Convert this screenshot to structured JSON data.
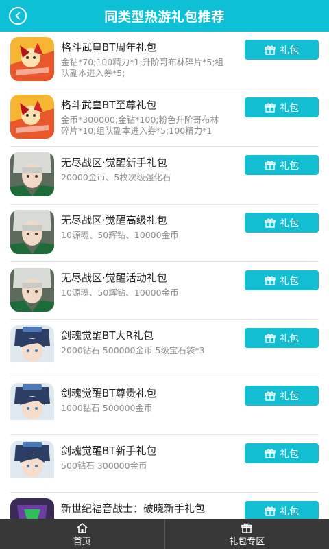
{
  "header": {
    "title": "同类型热游礼包推荐",
    "back_icon": "back-arrow-icon"
  },
  "colors": {
    "accent": "#0ec0d6",
    "button": "#14bed2",
    "tabbar": "#383838"
  },
  "items": [
    {
      "title": "格斗武皇BT周年礼包",
      "desc": "金钻*70;100精力*1;升阶哥布林碎片*5;组队副本进入券*5;",
      "button": "礼包",
      "icon": "fighter-game-icon"
    },
    {
      "title": "格斗武皇BT至尊礼包",
      "desc": "金币*300000;金钻*100;粉色升阶哥布林碎片*10;组队副本进入券*5;100精力*1",
      "button": "礼包",
      "icon": "fighter-game-icon"
    },
    {
      "title": "无尽战区·觉醒新手礼包",
      "desc": "20000金币、5枚次级强化石",
      "button": "礼包",
      "icon": "warzone-game-icon"
    },
    {
      "title": "无尽战区·觉醒高级礼包",
      "desc": "10源魂、50辉钻、10000金币",
      "button": "礼包",
      "icon": "warzone-game-icon"
    },
    {
      "title": "无尽战区·觉醒活动礼包",
      "desc": "10源魂、50辉钻、10000金币",
      "button": "礼包",
      "icon": "warzone-game-icon"
    },
    {
      "title": "剑魂觉醒BT大R礼包",
      "desc": "2000钻石 500000金币 5级宝石袋*3",
      "button": "礼包",
      "icon": "swordsoul-game-icon"
    },
    {
      "title": "剑魂觉醒BT尊贵礼包",
      "desc": "1000钻石 500000金币",
      "button": "礼包",
      "icon": "swordsoul-game-icon"
    },
    {
      "title": "剑魂觉醒BT新手礼包",
      "desc": "500钻石 300000金币",
      "button": "礼包",
      "icon": "swordsoul-game-icon"
    },
    {
      "title": "新世纪福音战士：破晓新手礼包",
      "desc": "",
      "button": "礼包",
      "icon": "eva-game-icon"
    }
  ],
  "tabbar": {
    "tabs": [
      {
        "label": "首页",
        "icon": "home-icon"
      },
      {
        "label": "礼包专区",
        "icon": "gift-icon"
      }
    ]
  }
}
